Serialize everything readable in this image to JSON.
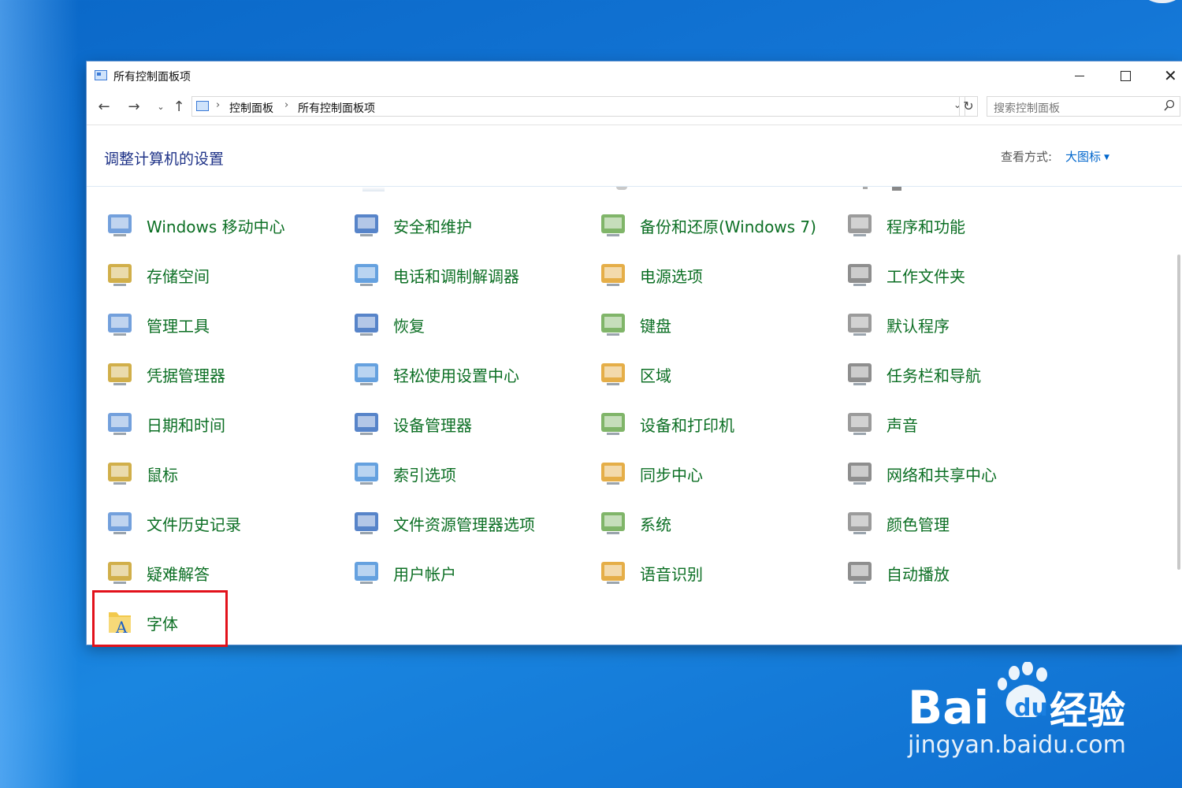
{
  "window": {
    "title": "所有控制面板项",
    "controls": {
      "minimize": "—",
      "maximize": "☐",
      "close": "✕"
    }
  },
  "nav": {
    "back": "←",
    "forward": "→",
    "recent": "⌄",
    "up": "↑",
    "breadcrumbs": [
      "控制面板",
      "所有控制面板项"
    ],
    "separator": "›",
    "refresh": "↻",
    "search_placeholder": "搜索控制面板"
  },
  "header": {
    "title": "调整计算机的设置",
    "view_by_label": "查看方式:",
    "view_by_value": "大图标"
  },
  "items": [
    [
      "Windows 移动中心",
      "安全和维护",
      "备份和还原(Windows 7)",
      "程序和功能"
    ],
    [
      "存储空间",
      "电话和调制解调器",
      "电源选项",
      "工作文件夹"
    ],
    [
      "管理工具",
      "恢复",
      "键盘",
      "默认程序"
    ],
    [
      "凭据管理器",
      "轻松使用设置中心",
      "区域",
      "任务栏和导航"
    ],
    [
      "日期和时间",
      "设备管理器",
      "设备和打印机",
      "声音"
    ],
    [
      "鼠标",
      "索引选项",
      "同步中心",
      "网络和共享中心"
    ],
    [
      "文件历史记录",
      "文件资源管理器选项",
      "系统",
      "颜色管理"
    ],
    [
      "疑难解答",
      "用户帐户",
      "语音识别",
      "自动播放"
    ],
    [
      "字体"
    ]
  ],
  "icons": [
    [
      "mobility-center-icon",
      "security-flag-icon",
      "backup-restore-icon",
      "programs-features-icon"
    ],
    [
      "storage-spaces-icon",
      "phone-modem-icon",
      "power-options-icon",
      "work-folders-icon"
    ],
    [
      "admin-tools-icon",
      "recovery-icon",
      "keyboard-icon",
      "default-programs-icon"
    ],
    [
      "credential-manager-icon",
      "ease-of-access-icon",
      "region-globe-icon",
      "taskbar-navigation-icon"
    ],
    [
      "date-time-icon",
      "device-manager-icon",
      "devices-printers-icon",
      "sound-icon"
    ],
    [
      "mouse-icon",
      "indexing-options-icon",
      "sync-center-icon",
      "network-sharing-icon"
    ],
    [
      "file-history-icon",
      "explorer-options-icon",
      "system-icon",
      "color-management-icon"
    ],
    [
      "troubleshooting-icon",
      "user-accounts-icon",
      "speech-recognition-icon",
      "autoplay-icon"
    ],
    [
      "fonts-icon"
    ]
  ],
  "colors": {
    "item_text": "#0c6f24",
    "title_text": "#1e3287",
    "link_blue": "#0066cc",
    "highlight_red": "#e2121b",
    "desktop_blue": "#1476d6"
  },
  "watermark": {
    "brand": "Bai",
    "brand_du": "du",
    "suffix": "经验",
    "url": "jingyan.baidu.com"
  }
}
